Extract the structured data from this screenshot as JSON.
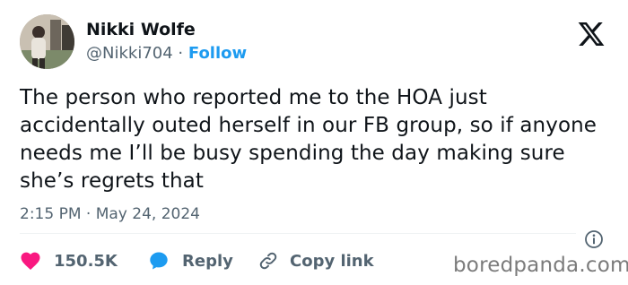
{
  "author": {
    "name": "Nikki Wolfe",
    "handle": "@Nikki704",
    "separator": "·",
    "follow_label": "Follow"
  },
  "tweet": {
    "text": "The person who reported me to the HOA just accidentally outed herself in our FB group, so if anyone needs me I’ll be busy spending the day making sure she’s regrets that",
    "timestamp": "2:15 PM · May 24, 2024"
  },
  "actions": {
    "likes_count": "150.5K",
    "reply_label": "Reply",
    "copy_link_label": "Copy link"
  },
  "icons": {
    "platform": "x-logo-icon",
    "info": "info-icon",
    "like": "heart-icon",
    "reply": "speech-bubble-icon",
    "copy": "link-icon"
  },
  "colors": {
    "follow": "#1d9bf0",
    "like": "#f91880",
    "reply": "#1d9bf0",
    "secondary_text": "#536471"
  },
  "watermark": "boredpanda.com"
}
